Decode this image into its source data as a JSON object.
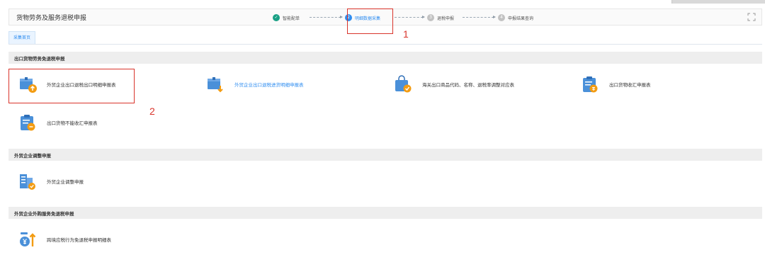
{
  "header": {
    "title": "货物劳务及服务退税申报",
    "steps": [
      {
        "num": "1",
        "label": "智能配单",
        "state": "done"
      },
      {
        "num": "2",
        "label": "明细数据采集",
        "state": "active"
      },
      {
        "num": "3",
        "label": "退税申报",
        "state": "todo"
      },
      {
        "num": "4",
        "label": "申报结果查询",
        "state": "todo"
      }
    ]
  },
  "annotations": {
    "marker_1": "1",
    "marker_2": "2",
    "color": "#d9342b"
  },
  "tab": {
    "label": "采集首页"
  },
  "sections": [
    {
      "title": "出口货物劳务免退税申报",
      "items": [
        {
          "label": "外贸企业出口退税出口明细申报表",
          "icon": "box-upload-icon"
        },
        {
          "label": "外贸企业出口退税进货明细申报表",
          "icon": "box-download-icon"
        },
        {
          "label": "海关出口商品代码、名称、退税率调整对应表",
          "icon": "bag-check-icon"
        },
        {
          "label": "出口货物收汇申报表",
          "icon": "clipboard-money-icon"
        },
        {
          "label": "出口货物不能收汇申报表",
          "icon": "clipboard-minus-icon"
        }
      ]
    },
    {
      "title": "外贸企业调整申报",
      "items": [
        {
          "label": "外贸企业调整申报",
          "icon": "document-adjust-icon"
        }
      ]
    },
    {
      "title": "外贸企业外购服务免退税申报",
      "items": [
        {
          "label": "跨境应税行为免退税申报明细表",
          "icon": "currency-arrow-icon"
        }
      ]
    }
  ],
  "colors": {
    "accent": "#2f8df0",
    "done": "#1aa085",
    "icon_blue": "#4a90d9",
    "icon_orange": "#f39c12"
  }
}
